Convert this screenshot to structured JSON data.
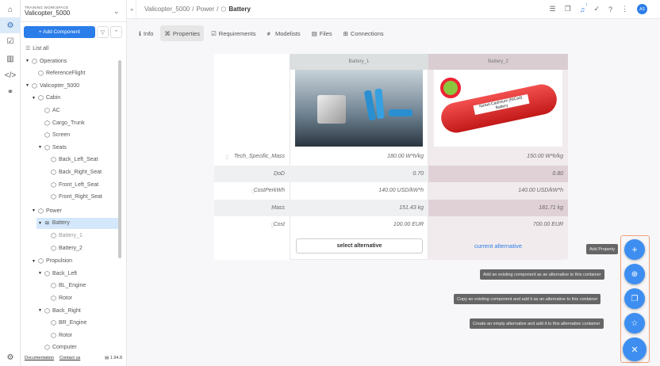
{
  "workspace": {
    "label": "TRAINING WORKSPACE",
    "name": "Valicopter_5000"
  },
  "sidebar": {
    "add_component": "+ Add Component",
    "list_all": "List all",
    "tree": [
      {
        "label": "Operations",
        "level": 0,
        "arrow": true
      },
      {
        "label": "ReferenceFlight",
        "level": 1
      },
      {
        "label": "Valicopter_5000",
        "level": 0,
        "arrow": true
      },
      {
        "label": "Cabin",
        "level": 1,
        "arrow": true
      },
      {
        "label": "AC",
        "level": 2
      },
      {
        "label": "Cargo_Trunk",
        "level": 2
      },
      {
        "label": "Screen",
        "level": 2
      },
      {
        "label": "Seats",
        "level": 2,
        "arrow": true
      },
      {
        "label": "Back_Left_Seat",
        "level": 3
      },
      {
        "label": "Back_Right_Seat",
        "level": 3
      },
      {
        "label": "Front_Left_Seat",
        "level": 3
      },
      {
        "label": "Front_Right_Seat",
        "level": 3
      },
      {
        "label": "Power",
        "level": 1,
        "arrow": true
      },
      {
        "label": "Battery",
        "level": 2,
        "arrow": true,
        "selected": true
      },
      {
        "label": "Battery_1",
        "level": 3,
        "dim": true
      },
      {
        "label": "Battery_2",
        "level": 3
      },
      {
        "label": "Propulsion",
        "level": 1,
        "arrow": true
      },
      {
        "label": "Back_Left",
        "level": 2,
        "arrow": true
      },
      {
        "label": "BL_Engine",
        "level": 3
      },
      {
        "label": "Rotor",
        "level": 3
      },
      {
        "label": "Back_Right",
        "level": 2,
        "arrow": true
      },
      {
        "label": "BR_Engine",
        "level": 3
      },
      {
        "label": "Rotor",
        "level": 3
      },
      {
        "label": "Computer",
        "level": 2
      }
    ],
    "documentation": "Documentation",
    "contact": "Contact us",
    "version": "1.94.8"
  },
  "breadcrumb": {
    "p1": "Valicopter_5000",
    "sep": "/",
    "p2": "Power",
    "current": "Battery"
  },
  "header": {
    "notification_count": "1",
    "avatar": "AS"
  },
  "tabs": [
    {
      "label": "Info",
      "icon": "ℹ"
    },
    {
      "label": "Properties",
      "icon": "⌘"
    },
    {
      "label": "Requirements",
      "icon": "☑"
    },
    {
      "label": "Modelists",
      "icon": "≢"
    },
    {
      "label": "Files",
      "icon": "▤"
    },
    {
      "label": "Connections",
      "icon": "⊞"
    }
  ],
  "table": {
    "alternatives": [
      "Battery_1",
      "Battery_2"
    ],
    "rows": [
      {
        "name": "Tech_Specific_Mass",
        "v1": "180.00  W*h/kg",
        "v2": "150.00  W*h/kg"
      },
      {
        "name": "DoD",
        "v1": "0.70",
        "v2": "0.80"
      },
      {
        "name": "CostPerkWh",
        "v1": "140.00  USD/kW*h",
        "v2": "140.00  USD/kW*h"
      },
      {
        "name": "Mass",
        "v1": "151.43  kg",
        "v2": "181.71  kg"
      },
      {
        "name": "Cost",
        "v1": "100.00  EUR",
        "v2": "700.00  EUR"
      }
    ],
    "select_alt": "select alternative",
    "current_alt": "current alternative",
    "battery2_image_text": "Nickel-Cadmium (NiCad) Battery"
  },
  "fab": {
    "tips": [
      "Add Property",
      "Add an existing component as an alternative to this container",
      "Copy an existing component and add it as an alternative to this container",
      "Create an empty alternative and add it to this alternative container"
    ]
  }
}
